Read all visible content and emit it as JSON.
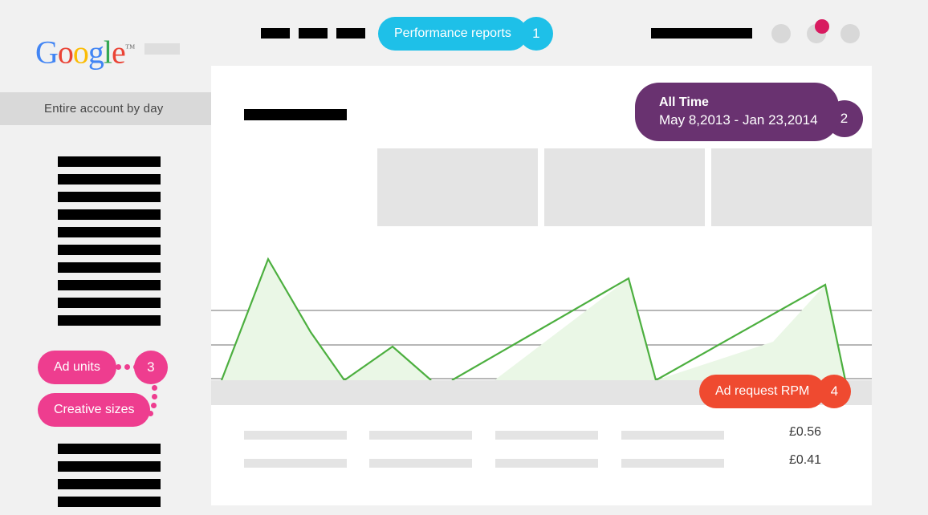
{
  "header": {
    "logo": {
      "letters": [
        "G",
        "o",
        "o",
        "g",
        "l",
        "e"
      ],
      "trademark": "™"
    },
    "nav_placeholder_count": 3,
    "performance_badge": {
      "label": "Performance reports",
      "number": "1",
      "color": "#1ec0e8"
    },
    "account_circles": 3,
    "notification_dot_color": "#d81b60"
  },
  "sidebar": {
    "section_label": "Entire account by day",
    "top_items_count": 10,
    "bottom_items_count": 4,
    "badges": [
      {
        "label": "Ad units",
        "number": "3",
        "color": "#ee3d8f"
      },
      {
        "label": "Creative sizes",
        "number": "",
        "color": "#ee3d8f"
      }
    ]
  },
  "panel": {
    "date_range_badge": {
      "title": "All Time",
      "range": "May 8,2013 - Jan 23,2014",
      "number": "2",
      "color": "#693270"
    },
    "stat_boxes": 3,
    "metric_badge": {
      "label": "Ad request RPM",
      "number": "4",
      "color": "#ef4a30"
    },
    "table": {
      "rows": [
        {
          "cells": [
            "",
            "",
            "",
            ""
          ],
          "value": "£0.56"
        },
        {
          "cells": [
            "",
            "",
            "",
            ""
          ],
          "value": "£0.41"
        }
      ]
    }
  },
  "chart_data": {
    "type": "area",
    "title": "",
    "xlabel": "",
    "ylabel": "",
    "series": [
      {
        "name": "Ad request RPM",
        "line_color": "#4caf3f",
        "fill_color": "#eaf7e6",
        "x": [
          13,
          71,
          124,
          166,
          226,
          274,
          300,
          353,
          520,
          554,
          700,
          765,
          790,
          823
        ],
        "values": [
          0,
          151,
          60,
          0,
          42,
          0,
          0,
          0,
          127,
          0,
          48,
          119,
          0,
          0
        ]
      }
    ],
    "gridlines_y": [
      90,
      133,
      175,
      217
    ],
    "ylim": [
      0,
      177
    ],
    "grid": true,
    "legend": "none"
  }
}
